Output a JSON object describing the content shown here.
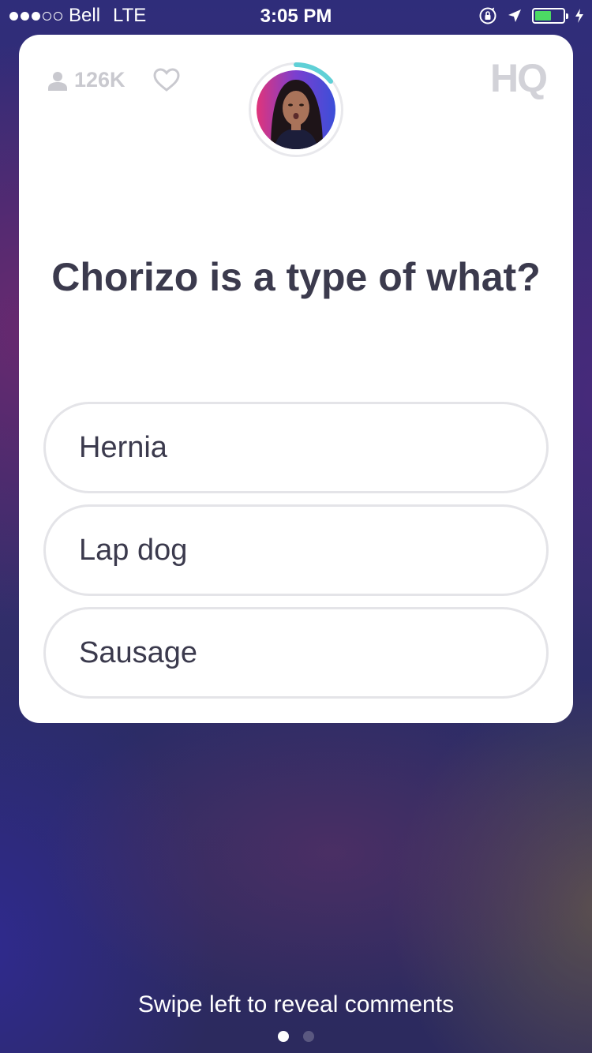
{
  "status_bar": {
    "carrier": "Bell",
    "network": "LTE",
    "time": "3:05 PM",
    "signal_filled": 3,
    "signal_total": 5,
    "battery_level": 0.6,
    "battery_color": "#4cd964"
  },
  "header": {
    "viewer_count": "126K",
    "logo": "HQ"
  },
  "question": {
    "text": "Chorizo is a type of what?"
  },
  "answers": [
    {
      "label": "Hernia"
    },
    {
      "label": "Lap dog"
    },
    {
      "label": "Sausage"
    }
  ],
  "footer": {
    "hint": "Swipe left to reveal comments",
    "page_count": 2,
    "active_page": 0
  },
  "colors": {
    "timer_ring": "#5fd0d6",
    "text_dark": "#3b3a4d",
    "muted": "#c9c9cf"
  },
  "icons": [
    "person-icon",
    "heart-icon",
    "location-arrow-icon",
    "orientation-lock-icon",
    "charging-bolt-icon"
  ]
}
